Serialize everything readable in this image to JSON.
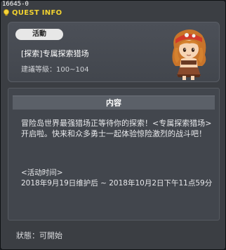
{
  "window": {
    "quest_id": "16645-0",
    "title": "QUEST INFO"
  },
  "header": {
    "category": "活動",
    "quest_name": "[探索]专属探索猎场",
    "level_label": "建議等級：100~104"
  },
  "content": {
    "header_label": "内容",
    "description": "冒险岛世界最强猎场正等待你的探索！<专属探索猎场>开启啦。快来和众多勇士一起体验惊险激烈的战斗吧！",
    "period_label": "<活动时间>",
    "period_text": "2018年9月19日维护后 ~ 2018年10月2日下午11点59分"
  },
  "footer": {
    "status": "狀態：可開始"
  },
  "colors": {
    "title": "#f2d230",
    "background": "#3b3e43",
    "panel": "#42464d"
  },
  "icons": {
    "title_icon": "lightbulb-icon",
    "npc": "npc-portrait"
  }
}
